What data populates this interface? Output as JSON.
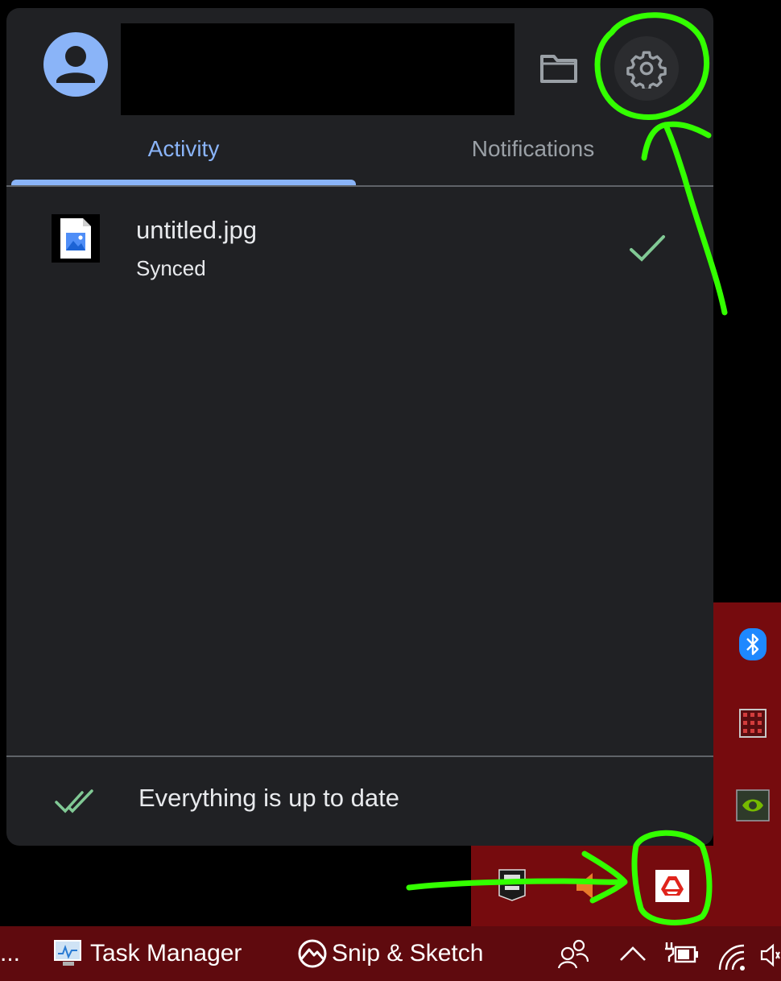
{
  "panel": {
    "tabs": [
      {
        "label": "Activity",
        "active": true
      },
      {
        "label": "Notifications",
        "active": false
      }
    ],
    "items": [
      {
        "name": "untitled.jpg",
        "status": "Synced",
        "icon": "image-file-icon"
      }
    ],
    "footer": {
      "status_text": "Everything is up to date",
      "icon": "double-check-icon"
    },
    "toolbar": {
      "folder_icon": "folder-icon",
      "settings_icon": "gear-icon"
    }
  },
  "taskbar": {
    "overflow_label": "...",
    "items": [
      {
        "label": "Task Manager",
        "icon": "task-manager-icon"
      },
      {
        "label": "Snip & Sketch",
        "icon": "snip-sketch-icon"
      }
    ]
  },
  "colors": {
    "panel_bg": "#202124",
    "accent_blue": "#8ab4f8",
    "synced_green": "#81c995",
    "annotation_green": "#33ff00",
    "taskbar_bg": "#5f0a0e"
  }
}
